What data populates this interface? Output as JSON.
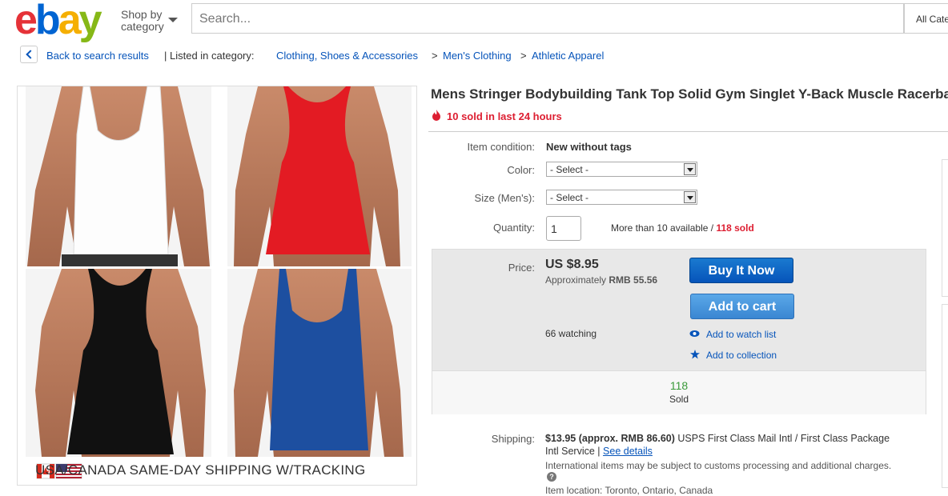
{
  "header": {
    "logo": [
      "e",
      "b",
      "a",
      "y"
    ],
    "logo_colors": [
      "#e53238",
      "#0064d2",
      "#f5af02",
      "#86b817"
    ],
    "shop_by_line1": "Shop by",
    "shop_by_line2": "category",
    "search_placeholder": "Search...",
    "category_select": "All Categories"
  },
  "breadcrumb": {
    "back_label": "Back to search results",
    "listed_in": "| Listed in category:",
    "crumbs": [
      "Clothing, Shoes & Accessories",
      "Men's Clothing",
      "Athletic Apparel"
    ],
    "separator": ">"
  },
  "gallery": {
    "shirt_colors": [
      "#ffffff",
      "#e31b23",
      "#111111",
      "#1d4fa0"
    ],
    "banner": "USA/CANADA SAME-DAY SHIPPING W/TRACKING"
  },
  "listing": {
    "title": "Mens Stringer Bodybuilding Tank Top Solid Gym Singlet Y-Back Muscle Racerback",
    "sold_24h": "10 sold in last 24 hours",
    "condition_label": "Item condition:",
    "condition_value": "New without tags",
    "color_label": "Color:",
    "color_value": "- Select -",
    "size_label": "Size (Men's):",
    "size_value": "- Select -",
    "quantity_label": "Quantity:",
    "quantity_value": "1",
    "availability": "More than 10 available /",
    "sold_count": "118 sold"
  },
  "buybox": {
    "price_label": "Price:",
    "price": "US $8.95",
    "approx_prefix": "Approximately",
    "approx_value": "RMB 55.56",
    "buy_now": "Buy It Now",
    "add_to_cart": "Add to cart",
    "watching": "66 watching",
    "watch_list": "Add to watch list",
    "collection": "Add to collection",
    "sold_number": "118",
    "sold_label": "Sold"
  },
  "shipping": {
    "label": "Shipping:",
    "cost": "$13.95",
    "approx": "(approx. RMB 86.60)",
    "service_line1": "USPS First Class Mail Intl / First Class Package",
    "service_line2": "Intl Service |",
    "see_details": "See details",
    "note": "International items may be subject to customs processing and additional charges.",
    "location": "Item location: Toronto, Ontario, Canada"
  }
}
